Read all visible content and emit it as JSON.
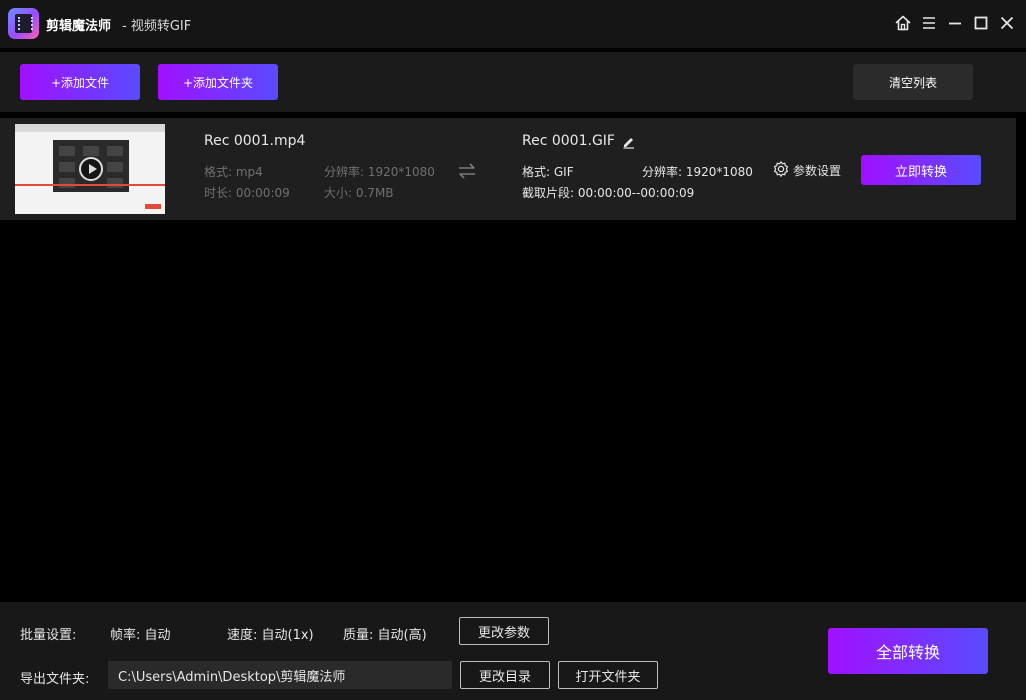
{
  "window": {
    "app_name": "剪辑魔法师",
    "subtitle": "- 视频转GIF",
    "icons": [
      "home-icon",
      "menu-icon",
      "minimize-icon",
      "maximize-icon",
      "close-icon"
    ]
  },
  "toolbar": {
    "add_file": "+添加文件",
    "add_folder": "+添加文件夹",
    "clear_list": "清空列表"
  },
  "file": {
    "source": {
      "name": "Rec 0001.mp4",
      "format": "格式: mp4",
      "resolution": "分辨率: 1920*1080",
      "duration": "时长: 00:00:09",
      "size": "大小: 0.7MB"
    },
    "target": {
      "name": "Rec 0001.GIF",
      "format": "格式: GIF",
      "resolution": "分辨率: 1920*1080",
      "segment": "截取片段: 00:00:00--00:00:09"
    },
    "settings_label": "参数设置",
    "convert_label": "立即转换"
  },
  "batch": {
    "label": "批量设置:",
    "fps": "帧率: 自动",
    "speed": "速度: 自动(1x)",
    "quality": "质量: 自动(高)",
    "change_params": "更改参数"
  },
  "export": {
    "label": "导出文件夹:",
    "path": "C:\\Users\\Admin\\Desktop\\剪辑魔法师",
    "change_dir": "更改目录",
    "open_folder": "打开文件夹"
  },
  "convert_all": "全部转换",
  "colors": {
    "accent_start": "#a010ff",
    "accent_end": "#5a4bff",
    "background": "#000000"
  }
}
